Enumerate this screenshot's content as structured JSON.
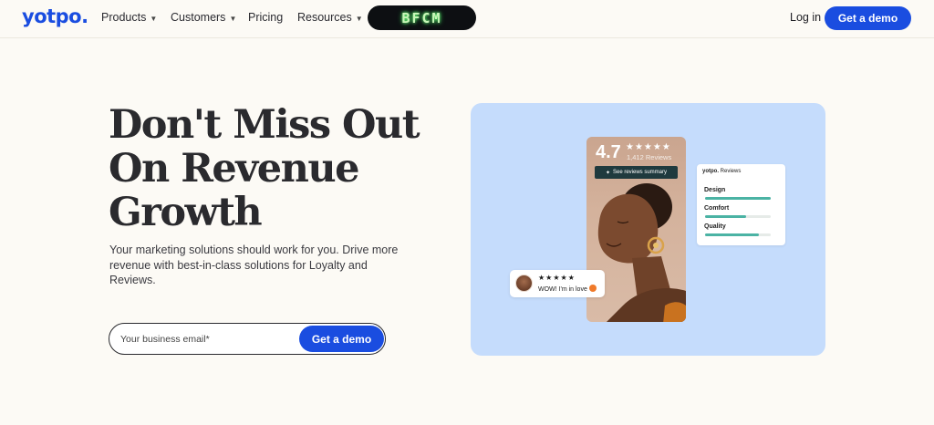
{
  "nav": {
    "logo": "yotpo.",
    "items": [
      {
        "label": "Products",
        "dropdown": true
      },
      {
        "label": "Customers",
        "dropdown": true
      },
      {
        "label": "Pricing",
        "dropdown": false
      },
      {
        "label": "Resources",
        "dropdown": true
      }
    ],
    "promo_badge": "BFCM",
    "login_label": "Log in",
    "demo_label": "Get a demo"
  },
  "hero": {
    "headline": [
      "Don't Miss Out",
      "On Revenue",
      "Growth"
    ],
    "subtext": "Your marketing solutions should work for you. Drive more revenue with best-in-class solutions for Loyalty and Reviews.",
    "email_placeholder": "Your business email*",
    "cta_label": "Get a demo"
  },
  "visual": {
    "rating_value": "4.7",
    "rating_stars": "★★★★★",
    "rating_count": "1,412 Reviews",
    "summary_chip": "See reviews summary",
    "ratings_card": {
      "brand": "yotpo.",
      "brand_suffix": "Reviews",
      "attributes": [
        {
          "label": "Design",
          "level": 1.0
        },
        {
          "label": "Comfort",
          "level": 0.62
        },
        {
          "label": "Quality",
          "level": 0.82
        }
      ]
    },
    "review": {
      "stars": "★★★★★",
      "text": "WOW! I'm in love"
    }
  },
  "colors": {
    "brand": "#1a4de0",
    "panel": "#c5dcfc",
    "bar": "#4bb3a4",
    "background": "#fcfaf5"
  }
}
